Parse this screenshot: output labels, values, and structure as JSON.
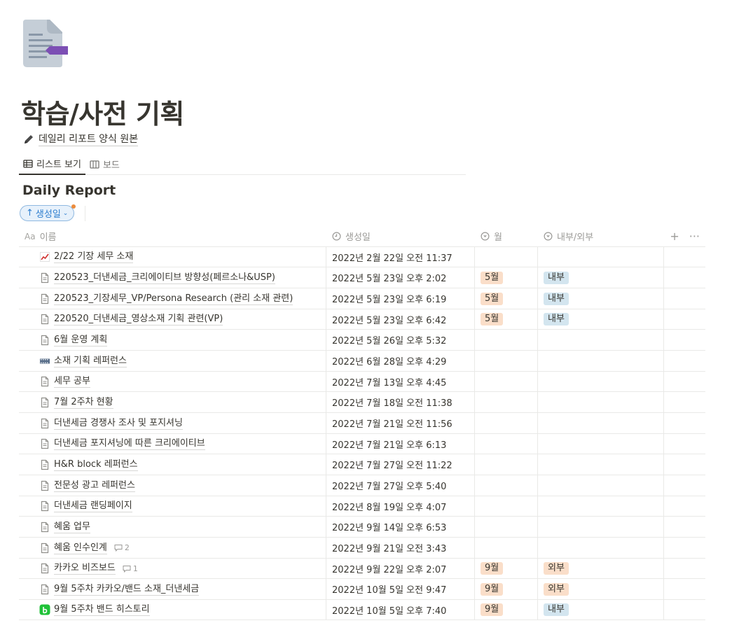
{
  "page": {
    "title": "학습/사전 기획",
    "icon": "document-icon",
    "linked_page": "데일리 리포트 양식 원본"
  },
  "views": [
    {
      "label": "리스트 보기",
      "icon": "table-icon",
      "active": true
    },
    {
      "label": "보드",
      "icon": "board-icon",
      "active": false
    }
  ],
  "database": {
    "title": "Daily Report",
    "sort_label": "생성일",
    "columns": {
      "name": "이름",
      "name_prefix": "Aa",
      "created": "생성일",
      "month": "월",
      "inout": "내부/외부"
    }
  },
  "colors": {
    "month_tag": "#fadec9",
    "internal_tag": "#d3e5ef",
    "external_tag": "#fadec9",
    "sep_tag": "#fadec9",
    "sort_chip_text": "#2f7fcf"
  },
  "rows": [
    {
      "icon": "chart-icon",
      "name": "2/22 기장 세무 소재",
      "created": "2022년 2월 22일 오전 11:37",
      "month": "",
      "inout": "",
      "comments": ""
    },
    {
      "icon": "page-icon",
      "name": "220523_더낸세금_크리에이티브 방향성(페르소나&USP)",
      "created": "2022년 5월 23일 오후 2:02",
      "month": "5월",
      "inout": "내부",
      "comments": ""
    },
    {
      "icon": "page-icon",
      "name": "220523_기장세무_VP/Persona Research (관리 소재 관련)",
      "created": "2022년 5월 23일 오후 6:19",
      "month": "5월",
      "inout": "내부",
      "comments": ""
    },
    {
      "icon": "page-icon",
      "name": "220520_더낸세금_영상소재 기획 관련(VP)",
      "created": "2022년 5월 23일 오후 6:42",
      "month": "5월",
      "inout": "내부",
      "comments": ""
    },
    {
      "icon": "page-icon",
      "name": "6월 운영 계획",
      "created": "2022년 5월 26일 오후 5:32",
      "month": "",
      "inout": "",
      "comments": ""
    },
    {
      "icon": "film-icon",
      "name": "소재 기획 레퍼런스",
      "created": "2022년 6월 28일 오후 4:29",
      "month": "",
      "inout": "",
      "comments": ""
    },
    {
      "icon": "page-icon",
      "name": "세무 공부",
      "created": "2022년 7월 13일 오후 4:45",
      "month": "",
      "inout": "",
      "comments": ""
    },
    {
      "icon": "page-icon",
      "name": "7월 2주차 현황",
      "created": "2022년 7월 18일 오전 11:38",
      "month": "",
      "inout": "",
      "comments": ""
    },
    {
      "icon": "page-icon",
      "name": "더낸세금 경쟁사 조사 및 포지셔닝",
      "created": "2022년 7월 21일 오전 11:56",
      "month": "",
      "inout": "",
      "comments": ""
    },
    {
      "icon": "page-icon",
      "name": "더낸세금 포지셔닝에 따른 크리에이티브",
      "created": "2022년 7월 21일 오후 6:13",
      "month": "",
      "inout": "",
      "comments": ""
    },
    {
      "icon": "page-icon",
      "name": "H&R block 레퍼런스",
      "created": "2022년 7월 27일 오전 11:22",
      "month": "",
      "inout": "",
      "comments": ""
    },
    {
      "icon": "page-icon",
      "name": "전문성 광고 레퍼런스",
      "created": "2022년 7월 27일 오후 5:40",
      "month": "",
      "inout": "",
      "comments": ""
    },
    {
      "icon": "page-icon",
      "name": "더낸세금 랜딩페이지",
      "created": "2022년 8월 19일 오후 4:07",
      "month": "",
      "inout": "",
      "comments": ""
    },
    {
      "icon": "page-icon",
      "name": "혜움 업무",
      "created": "2022년 9월 14일 오후 6:53",
      "month": "",
      "inout": "",
      "comments": ""
    },
    {
      "icon": "page-icon",
      "name": "혜움 인수인계",
      "created": "2022년 9월 21일 오전 3:43",
      "month": "",
      "inout": "",
      "comments": "2"
    },
    {
      "icon": "page-icon",
      "name": "카카오 비즈보드",
      "created": "2022년 9월 22일 오후 2:07",
      "month": "9월",
      "inout": "외부",
      "comments": "1"
    },
    {
      "icon": "page-icon",
      "name": "9월 5주차 카카오/밴드 소재_더낸세금",
      "created": "2022년 10월 5일 오전 9:47",
      "month": "9월",
      "inout": "외부",
      "comments": ""
    },
    {
      "icon": "band-icon",
      "name": "9월 5주차 밴드 히스토리",
      "created": "2022년 10월 5일 오후 7:40",
      "month": "9월",
      "inout": "내부",
      "comments": ""
    }
  ]
}
